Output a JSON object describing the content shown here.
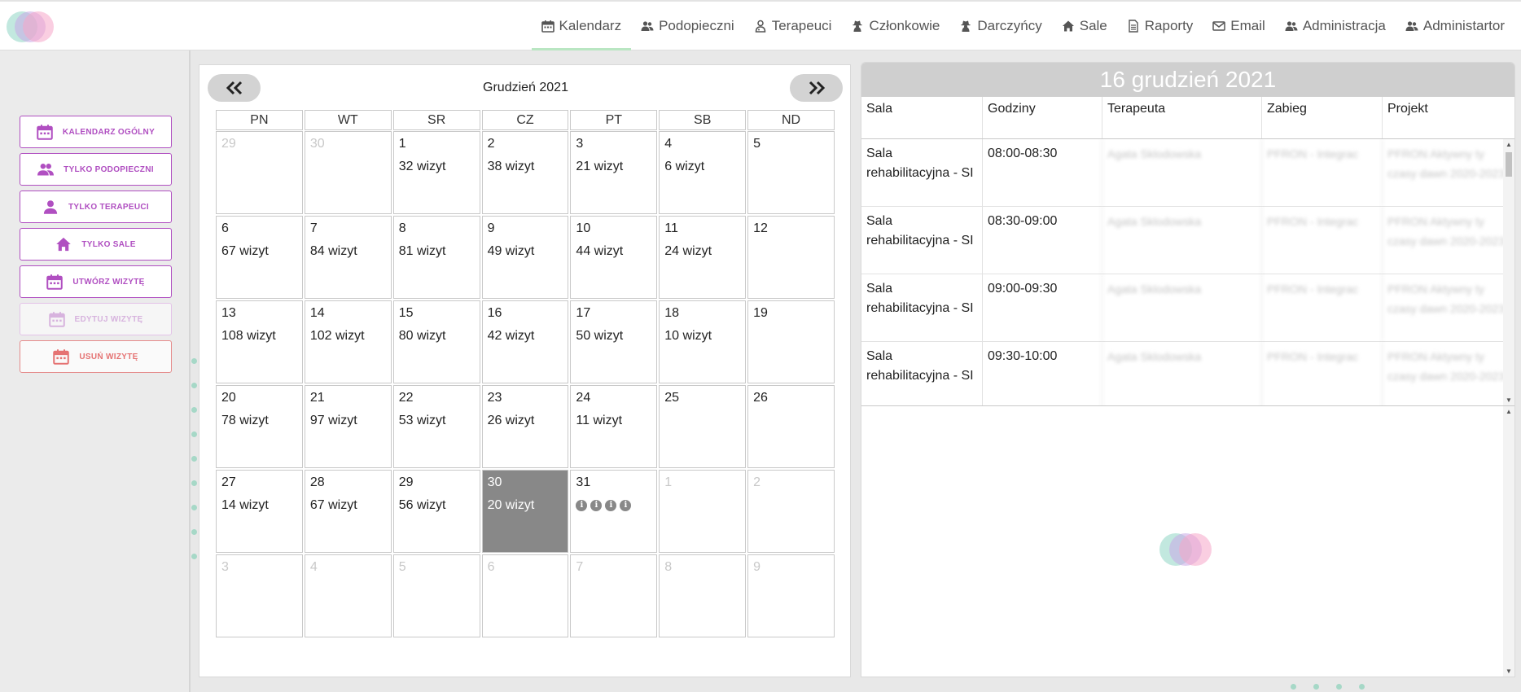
{
  "nav": {
    "items": [
      {
        "label": "Kalendarz",
        "icon": "calendar-icon",
        "active": true
      },
      {
        "label": "Podopieczni",
        "icon": "users-icon"
      },
      {
        "label": "Terapeuci",
        "icon": "user-md-icon"
      },
      {
        "label": "Członkowie",
        "icon": "user-secret-icon"
      },
      {
        "label": "Darczyńcy",
        "icon": "user-secret-icon"
      },
      {
        "label": "Sale",
        "icon": "home-icon"
      },
      {
        "label": "Raporty",
        "icon": "file-icon"
      },
      {
        "label": "Email",
        "icon": "envelope-icon"
      },
      {
        "label": "Administracja",
        "icon": "users-icon"
      },
      {
        "label": "Administartor",
        "icon": "users-icon"
      }
    ]
  },
  "sidebar": {
    "buttons": [
      {
        "label": "KALENDARZ OGÓLNY",
        "icon": "calendar-icon"
      },
      {
        "label": "TYLKO PODOPIECZNI",
        "icon": "people-icon"
      },
      {
        "label": "TYLKO TERAPEUCI",
        "icon": "person-icon"
      },
      {
        "label": "TYLKO SALE",
        "icon": "home-icon"
      },
      {
        "label": "UTWÓRZ WIZYTĘ",
        "icon": "calendar-icon"
      },
      {
        "label": "EDYTUJ WIZYTĘ",
        "icon": "calendar-icon",
        "disabled": true
      },
      {
        "label": "USUŃ WIZYTĘ",
        "icon": "calendar-icon",
        "danger": true
      }
    ]
  },
  "calendar": {
    "month_title": "Grudzień 2021",
    "weekdays": [
      "PN",
      "WT",
      "SR",
      "CZ",
      "PT",
      "SB",
      "ND"
    ],
    "selected_day": 30,
    "weeks": [
      [
        {
          "d": "29",
          "o": true
        },
        {
          "d": "30",
          "o": true
        },
        {
          "d": "1",
          "v": "32 wizyt"
        },
        {
          "d": "2",
          "v": "38 wizyt"
        },
        {
          "d": "3",
          "v": "21 wizyt"
        },
        {
          "d": "4",
          "v": "6 wizyt"
        },
        {
          "d": "5"
        }
      ],
      [
        {
          "d": "6",
          "v": "67 wizyt"
        },
        {
          "d": "7",
          "v": "84 wizyt"
        },
        {
          "d": "8",
          "v": "81 wizyt"
        },
        {
          "d": "9",
          "v": "49 wizyt"
        },
        {
          "d": "10",
          "v": "44 wizyt"
        },
        {
          "d": "11",
          "v": "24 wizyt"
        },
        {
          "d": "12"
        }
      ],
      [
        {
          "d": "13",
          "v": "108 wizyt"
        },
        {
          "d": "14",
          "v": "102 wizyt"
        },
        {
          "d": "15",
          "v": "80 wizyt"
        },
        {
          "d": "16",
          "v": "42 wizyt"
        },
        {
          "d": "17",
          "v": "50 wizyt"
        },
        {
          "d": "18",
          "v": "10 wizyt"
        },
        {
          "d": "19"
        }
      ],
      [
        {
          "d": "20",
          "v": "78 wizyt"
        },
        {
          "d": "21",
          "v": "97 wizyt"
        },
        {
          "d": "22",
          "v": "53 wizyt"
        },
        {
          "d": "23",
          "v": "26 wizyt"
        },
        {
          "d": "24",
          "v": "11 wizyt"
        },
        {
          "d": "25"
        },
        {
          "d": "26"
        }
      ],
      [
        {
          "d": "27",
          "v": "14 wizyt"
        },
        {
          "d": "28",
          "v": "67 wizyt"
        },
        {
          "d": "29",
          "v": "56 wizyt"
        },
        {
          "d": "30",
          "v": "20 wizyt",
          "sel": true
        },
        {
          "d": "31",
          "info": 4
        },
        {
          "d": "1",
          "o": true
        },
        {
          "d": "2",
          "o": true
        }
      ],
      [
        {
          "d": "3",
          "o": true
        },
        {
          "d": "4",
          "o": true
        },
        {
          "d": "5",
          "o": true
        },
        {
          "d": "6",
          "o": true
        },
        {
          "d": "7",
          "o": true
        },
        {
          "d": "8",
          "o": true
        },
        {
          "d": "9",
          "o": true
        }
      ]
    ]
  },
  "day_panel": {
    "title": "16 grudzień 2021",
    "columns": [
      "Sala",
      "Godziny",
      "Terapeuta",
      "Zabieg",
      "Projekt"
    ],
    "rows": [
      {
        "sala": "Sala rehabilitacyjna - SI",
        "godziny": "08:00-08:30",
        "terapeuta": "Agata Sklodowska",
        "zabieg": "PFRON - Integrac",
        "projekt": "PFRON Aktywny ty czasy dawn 2020-2023"
      },
      {
        "sala": "Sala rehabilitacyjna - SI",
        "godziny": "08:30-09:00",
        "terapeuta": "Agata Sklodowska",
        "zabieg": "PFRON - Integrac",
        "projekt": "PFRON Aktywny ty czasy dawn 2020-2023"
      },
      {
        "sala": "Sala rehabilitacyjna - SI",
        "godziny": "09:00-09:30",
        "terapeuta": "Agata Sklodowska",
        "zabieg": "PFRON - Integrac",
        "projekt": "PFRON Aktywny ty czasy dawn 2020-2023"
      },
      {
        "sala": "Sala rehabilitacyjna - SI",
        "godziny": "09:30-10:00",
        "terapeuta": "Agata Sklodowska",
        "zabieg": "PFRON - Integrac",
        "projekt": "PFRON Aktywny ty czasy dawn 2020-2023"
      }
    ]
  },
  "colors": {
    "accent": "#b04fc1",
    "danger": "#e57373",
    "selected_day": "#888888",
    "logo": [
      "#8fd6c4",
      "#c9a7e6",
      "#f5a6c9"
    ]
  }
}
